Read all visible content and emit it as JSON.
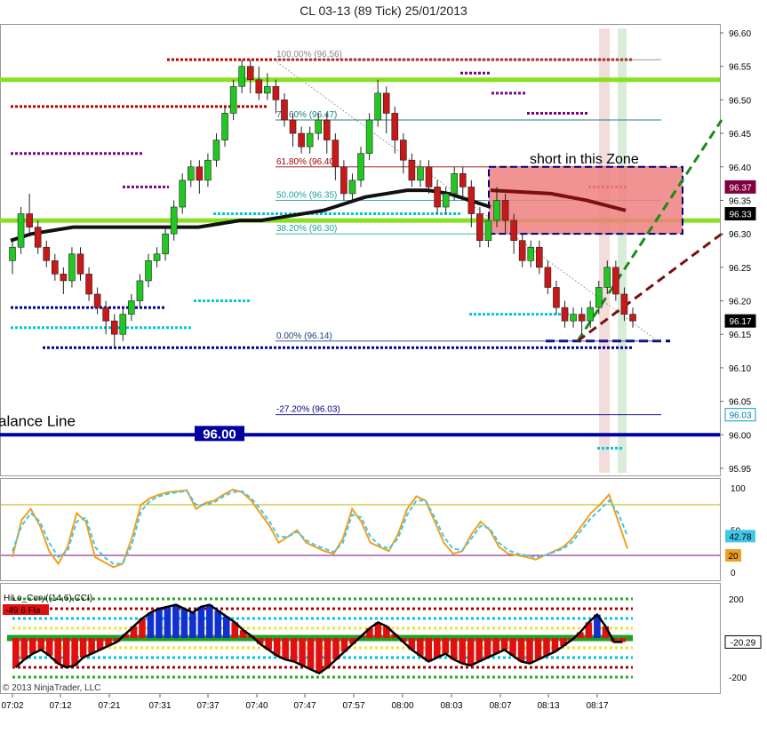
{
  "header": {
    "title": "CL 03-13 (89 Tick)  25/01/2013"
  },
  "chart_data": [
    {
      "type": "candlestick",
      "title": "CL 03-13 (89 Tick)  25/01/2013",
      "ylim": [
        95.93,
        96.62
      ],
      "y_ticks": [
        "96.60",
        "96.55",
        "96.50",
        "96.45",
        "96.40",
        "96.35",
        "96.30",
        "96.25",
        "96.20",
        "96.15",
        "96.10",
        "96.05",
        "96.00",
        "95.95"
      ],
      "x_ticks": [
        "07:02",
        "07:12",
        "07:21",
        "07:31",
        "07:37",
        "07:40",
        "07:47",
        "07:57",
        "08:00",
        "08:03",
        "08:07",
        "08:13",
        "08:17"
      ],
      "fibonacci": [
        {
          "label": "100.00% (96.56)",
          "value": 96.56
        },
        {
          "label": "78.60% (96.47)",
          "value": 96.47
        },
        {
          "label": "61.80% (96.40)",
          "value": 96.4
        },
        {
          "label": "50.00% (96.35)",
          "value": 96.35
        },
        {
          "label": "38.20% (96.30)",
          "value": 96.3
        },
        {
          "label": "0.00% (96.14)",
          "value": 96.14
        },
        {
          "label": "-27.20% (96.03)",
          "value": 96.03
        }
      ],
      "green_lines": [
        96.53,
        96.32
      ],
      "balance_line": {
        "label": "alance Line",
        "value": 96.0,
        "badge": "96.00"
      },
      "zone": {
        "label": "short in this Zone",
        "top": 96.4,
        "bottom": 96.3
      },
      "price_badges": [
        {
          "text": "96.37",
          "value": 96.37,
          "color": "#800040"
        },
        {
          "text": "96.33",
          "value": 96.33,
          "color": "#000000"
        },
        {
          "text": "96.17",
          "value": 96.17,
          "color": "#000000"
        },
        {
          "text": "96.03",
          "value": 96.03,
          "color": "#00a0c0"
        }
      ],
      "candles": [
        [
          96.26,
          96.28,
          96.24,
          96.29
        ],
        [
          96.28,
          96.33,
          96.27,
          96.34
        ],
        [
          96.33,
          96.31,
          96.3,
          96.36
        ],
        [
          96.31,
          96.28,
          96.27,
          96.32
        ],
        [
          96.28,
          96.26,
          96.25,
          96.29
        ],
        [
          96.26,
          96.24,
          96.23,
          96.27
        ],
        [
          96.24,
          96.23,
          96.21,
          96.25
        ],
        [
          96.23,
          96.27,
          96.22,
          96.28
        ],
        [
          96.27,
          96.24,
          96.23,
          96.28
        ],
        [
          96.24,
          96.21,
          96.2,
          96.25
        ],
        [
          96.21,
          96.19,
          96.18,
          96.22
        ],
        [
          96.19,
          96.17,
          96.15,
          96.2
        ],
        [
          96.17,
          96.15,
          96.13,
          96.18
        ],
        [
          96.15,
          96.18,
          96.14,
          96.19
        ],
        [
          96.18,
          96.2,
          96.17,
          96.21
        ],
        [
          96.2,
          96.23,
          96.19,
          96.24
        ],
        [
          96.23,
          96.26,
          96.22,
          96.27
        ],
        [
          96.26,
          96.27,
          96.25,
          96.28
        ],
        [
          96.27,
          96.3,
          96.26,
          96.31
        ],
        [
          96.3,
          96.34,
          96.29,
          96.35
        ],
        [
          96.34,
          96.38,
          96.33,
          96.39
        ],
        [
          96.38,
          96.4,
          96.37,
          96.41
        ],
        [
          96.4,
          96.38,
          96.36,
          96.41
        ],
        [
          96.38,
          96.41,
          96.37,
          96.42
        ],
        [
          96.41,
          96.44,
          96.4,
          96.45
        ],
        [
          96.44,
          96.48,
          96.43,
          96.49
        ],
        [
          96.48,
          96.52,
          96.47,
          96.53
        ],
        [
          96.52,
          96.55,
          96.51,
          96.56
        ],
        [
          96.55,
          96.53,
          96.51,
          96.56
        ],
        [
          96.53,
          96.51,
          96.5,
          96.55
        ],
        [
          96.51,
          96.52,
          96.5,
          96.54
        ],
        [
          96.52,
          96.5,
          96.48,
          96.53
        ],
        [
          96.5,
          96.47,
          96.46,
          96.51
        ],
        [
          96.47,
          96.45,
          96.43,
          96.48
        ],
        [
          96.45,
          96.43,
          96.42,
          96.46
        ],
        [
          96.43,
          96.45,
          96.42,
          96.46
        ],
        [
          96.45,
          96.47,
          96.44,
          96.48
        ],
        [
          96.47,
          96.44,
          96.42,
          96.48
        ],
        [
          96.44,
          96.4,
          96.38,
          96.45
        ],
        [
          96.4,
          96.36,
          96.35,
          96.41
        ],
        [
          96.36,
          96.38,
          96.35,
          96.39
        ],
        [
          96.38,
          96.42,
          96.37,
          96.43
        ],
        [
          96.42,
          96.47,
          96.41,
          96.48
        ],
        [
          96.47,
          96.51,
          96.46,
          96.53
        ],
        [
          96.51,
          96.48,
          96.45,
          96.52
        ],
        [
          96.48,
          96.44,
          96.42,
          96.49
        ],
        [
          96.44,
          96.41,
          96.39,
          96.45
        ],
        [
          96.41,
          96.38,
          96.37,
          96.42
        ],
        [
          96.38,
          96.4,
          96.37,
          96.41
        ],
        [
          96.4,
          96.37,
          96.36,
          96.41
        ],
        [
          96.37,
          96.34,
          96.33,
          96.38
        ],
        [
          96.34,
          96.36,
          96.33,
          96.37
        ],
        [
          96.36,
          96.39,
          96.35,
          96.4
        ],
        [
          96.39,
          96.37,
          96.35,
          96.4
        ],
        [
          96.37,
          96.33,
          96.31,
          96.38
        ],
        [
          96.33,
          96.29,
          96.28,
          96.34
        ],
        [
          96.29,
          96.32,
          96.28,
          96.33
        ],
        [
          96.32,
          96.35,
          96.31,
          96.37
        ],
        [
          96.35,
          96.32,
          96.3,
          96.36
        ],
        [
          96.32,
          96.29,
          96.27,
          96.33
        ],
        [
          96.29,
          96.26,
          96.25,
          96.3
        ],
        [
          96.26,
          96.28,
          96.25,
          96.29
        ],
        [
          96.28,
          96.25,
          96.24,
          96.29
        ],
        [
          96.25,
          96.22,
          96.21,
          96.26
        ],
        [
          96.22,
          96.19,
          96.18,
          96.23
        ],
        [
          96.19,
          96.17,
          96.16,
          96.2
        ],
        [
          96.17,
          96.18,
          96.16,
          96.19
        ],
        [
          96.18,
          96.17,
          96.15,
          96.19
        ],
        [
          96.17,
          96.19,
          96.16,
          96.2
        ],
        [
          96.19,
          96.22,
          96.18,
          96.23
        ],
        [
          96.22,
          96.25,
          96.21,
          96.26
        ],
        [
          96.25,
          96.21,
          96.2,
          96.26
        ],
        [
          96.21,
          96.18,
          96.17,
          96.22
        ],
        [
          96.18,
          96.17,
          96.16,
          96.19
        ]
      ]
    },
    {
      "type": "line",
      "y_ticks": [
        "100",
        "50",
        "0"
      ],
      "level_lines": [
        80,
        20
      ],
      "badges": [
        {
          "text": "42.78",
          "value": 42.78
        },
        {
          "text": "20",
          "value": 20
        }
      ],
      "series": [
        {
          "color": "#f0a020",
          "values": [
            18,
            62,
            75,
            55,
            25,
            10,
            30,
            70,
            60,
            18,
            12,
            6,
            10,
            40,
            80,
            88,
            92,
            95,
            96,
            97,
            75,
            82,
            85,
            92,
            98,
            95,
            85,
            70,
            55,
            35,
            42,
            50,
            35,
            30,
            25,
            22,
            40,
            75,
            60,
            35,
            30,
            25,
            45,
            75,
            90,
            85,
            60,
            35,
            22,
            25,
            45,
            60,
            50,
            30,
            22,
            20,
            18,
            15,
            20,
            25,
            30,
            40,
            55,
            70,
            80,
            92,
            60,
            28
          ]
        },
        {
          "color": "#40c8e8",
          "values": [
            25,
            55,
            70,
            60,
            35,
            18,
            25,
            60,
            65,
            30,
            18,
            10,
            10,
            32,
            72,
            85,
            90,
            93,
            95,
            96,
            80,
            80,
            83,
            90,
            95,
            96,
            88,
            75,
            60,
            42,
            42,
            48,
            38,
            32,
            28,
            24,
            35,
            68,
            65,
            42,
            32,
            28,
            40,
            68,
            85,
            85,
            65,
            42,
            28,
            26,
            40,
            55,
            52,
            35,
            26,
            22,
            20,
            18,
            20,
            24,
            28,
            36,
            50,
            64,
            74,
            85,
            70,
            42.78
          ]
        }
      ]
    },
    {
      "type": "bar",
      "label": "HiLo_Cory((14,6),CCI)",
      "flag": "-49 6 Fla",
      "y_ticks": [
        "200",
        "-200"
      ],
      "badge": {
        "text": "-20.29",
        "value": -20.29
      },
      "values": [
        -150,
        -110,
        -80,
        -60,
        -90,
        -130,
        -150,
        -140,
        -100,
        -80,
        -60,
        -40,
        -20,
        20,
        60,
        100,
        130,
        150,
        160,
        170,
        150,
        130,
        160,
        170,
        140,
        110,
        80,
        40,
        10,
        -30,
        -60,
        -90,
        -110,
        -120,
        -140,
        -160,
        -180,
        -150,
        -110,
        -70,
        -30,
        10,
        50,
        80,
        60,
        20,
        -20,
        -60,
        -90,
        -120,
        -100,
        -80,
        -110,
        -130,
        -140,
        -120,
        -100,
        -80,
        -60,
        -90,
        -120,
        -130,
        -110,
        -90,
        -70,
        -40,
        -10,
        30,
        80,
        120,
        60,
        -20,
        -20.29
      ]
    }
  ]
}
